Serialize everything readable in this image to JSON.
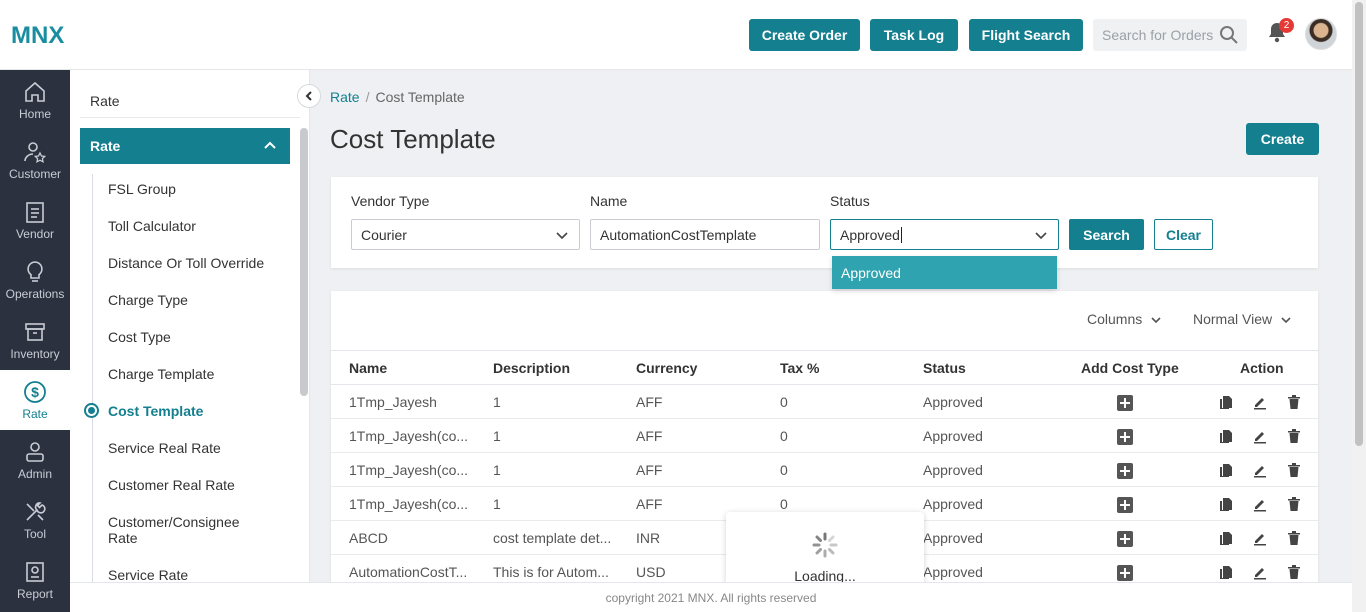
{
  "brand": {
    "logo": "MNX"
  },
  "header": {
    "buttons": [
      "Create Order",
      "Task Log",
      "Flight Search"
    ],
    "search_placeholder": "Search for Orders",
    "notification_count": "2"
  },
  "rail": [
    {
      "label": "Home",
      "icon": "home-icon"
    },
    {
      "label": "Customer",
      "icon": "customer-icon"
    },
    {
      "label": "Vendor",
      "icon": "vendor-icon"
    },
    {
      "label": "Operations",
      "icon": "lightbulb-icon"
    },
    {
      "label": "Inventory",
      "icon": "inventory-icon"
    },
    {
      "label": "Rate",
      "icon": "dollar-icon"
    },
    {
      "label": "Admin",
      "icon": "admin-icon"
    },
    {
      "label": "Tool",
      "icon": "tools-icon"
    },
    {
      "label": "Report",
      "icon": "report-icon"
    }
  ],
  "submenu": {
    "title": "Rate",
    "section": "Rate",
    "items": [
      "FSL Group",
      "Toll Calculator",
      "Distance Or Toll Override",
      "Charge Type",
      "Cost Type",
      "Charge Template",
      "Cost Template",
      "Service Real Rate",
      "Customer Real Rate",
      "Customer/Consignee Rate",
      "Service Rate"
    ],
    "active": "Cost Template"
  },
  "breadcrumb": {
    "root": "Rate",
    "sep": "/",
    "current": "Cost Template"
  },
  "page": {
    "title": "Cost Template",
    "create_label": "Create"
  },
  "filters": {
    "vendor_type_label": "Vendor Type",
    "vendor_type_value": "Courier",
    "name_label": "Name",
    "name_value": "AutomationCostTemplate",
    "status_label": "Status",
    "status_value": "Approved",
    "status_option": "Approved",
    "search_label": "Search",
    "clear_label": "Clear"
  },
  "table": {
    "columns_label": "Columns",
    "view_label": "Normal View",
    "headers": [
      "Name",
      "Description",
      "Currency",
      "Tax %",
      "Status",
      "Add Cost Type",
      "Action"
    ],
    "rows": [
      [
        "1Tmp_Jayesh",
        "1",
        "AFF",
        "0",
        "Approved"
      ],
      [
        "1Tmp_Jayesh(co...",
        "1",
        "AFF",
        "0",
        "Approved"
      ],
      [
        "1Tmp_Jayesh(co...",
        "1",
        "AFF",
        "0",
        "Approved"
      ],
      [
        "1Tmp_Jayesh(co...",
        "1",
        "AFF",
        "0",
        "Approved"
      ],
      [
        "ABCD",
        "cost template det...",
        "INR",
        "",
        "Approved"
      ],
      [
        "AutomationCostT...",
        "This is for Autom...",
        "USD",
        "",
        "Approved"
      ]
    ]
  },
  "loading_text": "Loading...",
  "footer": "copyright 2021 MNX. All rights reserved",
  "colors": {
    "accent": "#137f8f",
    "rail_bg": "#2c3140",
    "dropdown_highlight": "#2fa4b0",
    "badge": "#e53935"
  }
}
